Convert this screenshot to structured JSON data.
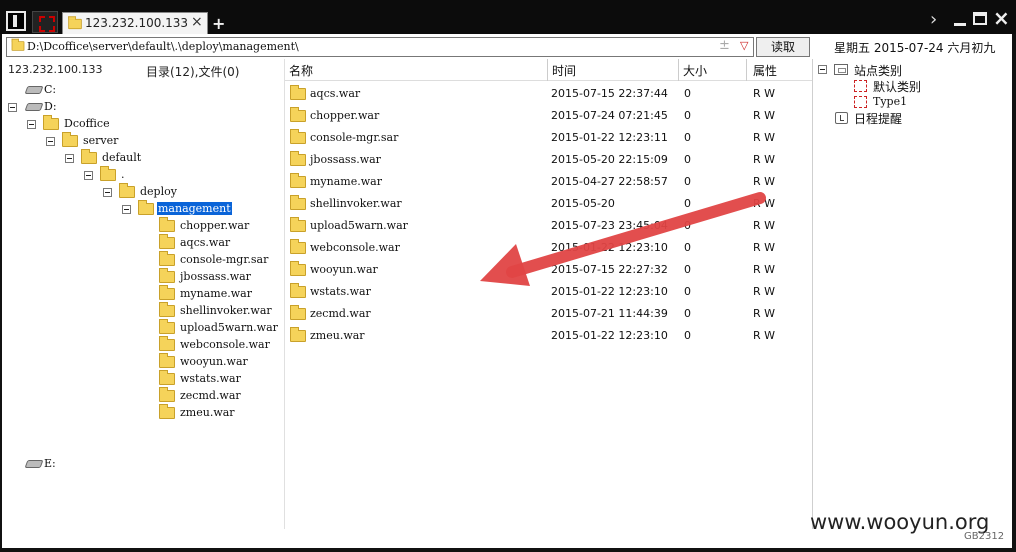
{
  "titlebar": {
    "tab_label": "123.232.100.133",
    "tab_close": "×",
    "new_tab": "+",
    "next": "›",
    "close": "×"
  },
  "address": {
    "path": "D:\\Dcoffice\\server\\default\\.\\deploy\\management\\",
    "plus": "±",
    "dropdown": "▽",
    "read_label": "读取"
  },
  "date_text": "星期五 2015-07-24 六月初九",
  "left_header": {
    "host": "123.232.100.133",
    "count": "目录(12),文件(0)"
  },
  "columns": {
    "name": "名称",
    "time": "时间",
    "size": "大小",
    "attr": "属性"
  },
  "tree": {
    "c_drive": "C:",
    "d_drive": "D:",
    "dcoffice": "Dcoffice",
    "server": "server",
    "default": "default",
    "dot": ".",
    "deploy": "deploy",
    "management": "management",
    "children": [
      "chopper.war",
      "aqcs.war",
      "console-mgr.sar",
      "jbossass.war",
      "myname.war",
      "shellinvoker.war",
      "upload5warn.war",
      "webconsole.war",
      "wooyun.war",
      "wstats.war",
      "zecmd.war",
      "zmeu.war"
    ],
    "e_drive": "E:"
  },
  "files": [
    {
      "name": "aqcs.war",
      "time": "2015-07-15 22:37:44",
      "size": "0",
      "attr": "R W"
    },
    {
      "name": "chopper.war",
      "time": "2015-07-24 07:21:45",
      "size": "0",
      "attr": "R W"
    },
    {
      "name": "console-mgr.sar",
      "time": "2015-01-22 12:23:11",
      "size": "0",
      "attr": "R W"
    },
    {
      "name": "jbossass.war",
      "time": "2015-05-20 22:15:09",
      "size": "0",
      "attr": "R W"
    },
    {
      "name": "myname.war",
      "time": "2015-04-27 22:58:57",
      "size": "0",
      "attr": "R W"
    },
    {
      "name": "shellinvoker.war",
      "time": "2015-05-20",
      "size": "0",
      "attr": "R W"
    },
    {
      "name": "upload5warn.war",
      "time": "2015-07-23 23:45:04",
      "size": "0",
      "attr": "R W"
    },
    {
      "name": "webconsole.war",
      "time": "2015-01-22 12:23:10",
      "size": "0",
      "attr": "R W"
    },
    {
      "name": "wooyun.war",
      "time": "2015-07-15 22:27:32",
      "size": "0",
      "attr": "R W"
    },
    {
      "name": "wstats.war",
      "time": "2015-01-22 12:23:10",
      "size": "0",
      "attr": "R W"
    },
    {
      "name": "zecmd.war",
      "time": "2015-07-21 11:44:39",
      "size": "0",
      "attr": "R W"
    },
    {
      "name": "zmeu.war",
      "time": "2015-01-22 12:23:10",
      "size": "0",
      "attr": "R W"
    }
  ],
  "sidebar": {
    "site_category": "站点类别",
    "default_category": "默认类别",
    "type1": "Type1",
    "schedule": "日程提醒"
  },
  "watermark": "www.wooyun.org",
  "encoding": "GB2312",
  "colors": {
    "selection": "#0a64d8",
    "annotation_arrow": "#e04545",
    "folder": "#f5d35a"
  }
}
